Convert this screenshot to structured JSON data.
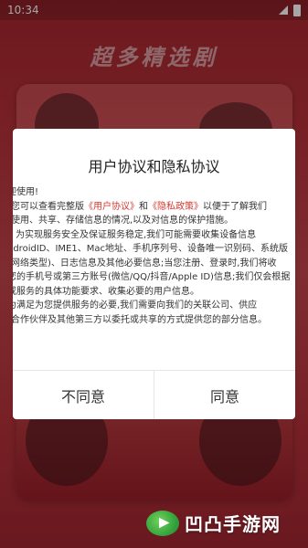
{
  "status_bar": {
    "time": "10:34"
  },
  "splash": {
    "title": "超多精选剧"
  },
  "dialog": {
    "title": "用户协议和隐私协议",
    "body_lines": [
      "迎使用!",
      "您可以查看完整版",
      "使用、共享、存储信息的情况,以及对信息的保护措施。",
      "为实现服务安全及保证服务稳定,我们可能需要收集设备信息",
      "ndroidID、IME1、Mac地址、手机序列号、设备唯一识别码、系统版",
      "网络类型)、日志信息及其他必要信息;当您注册、登录时,我们将收",
      "您的手机号或第三方账号(微信/QQ/抖音/Apple ID)信息;我们仅会根据",
      "或服务的具体功能要求、收集必要的用户信息。",
      "为满足为您提供服务的必要,我们需要向我们的关联公司、供应",
      "合作伙伴及其他第三方以委托或共享的方式提供您的部分信息。"
    ],
    "link_user_agreement": "《用户协议》",
    "and_text": "和",
    "link_privacy_policy": "《隐私政策》",
    "after_links": "以便于了解我们",
    "disagree_label": "不同意",
    "agree_label": "同意"
  },
  "watermark": {
    "text": "凹凸手游网"
  }
}
